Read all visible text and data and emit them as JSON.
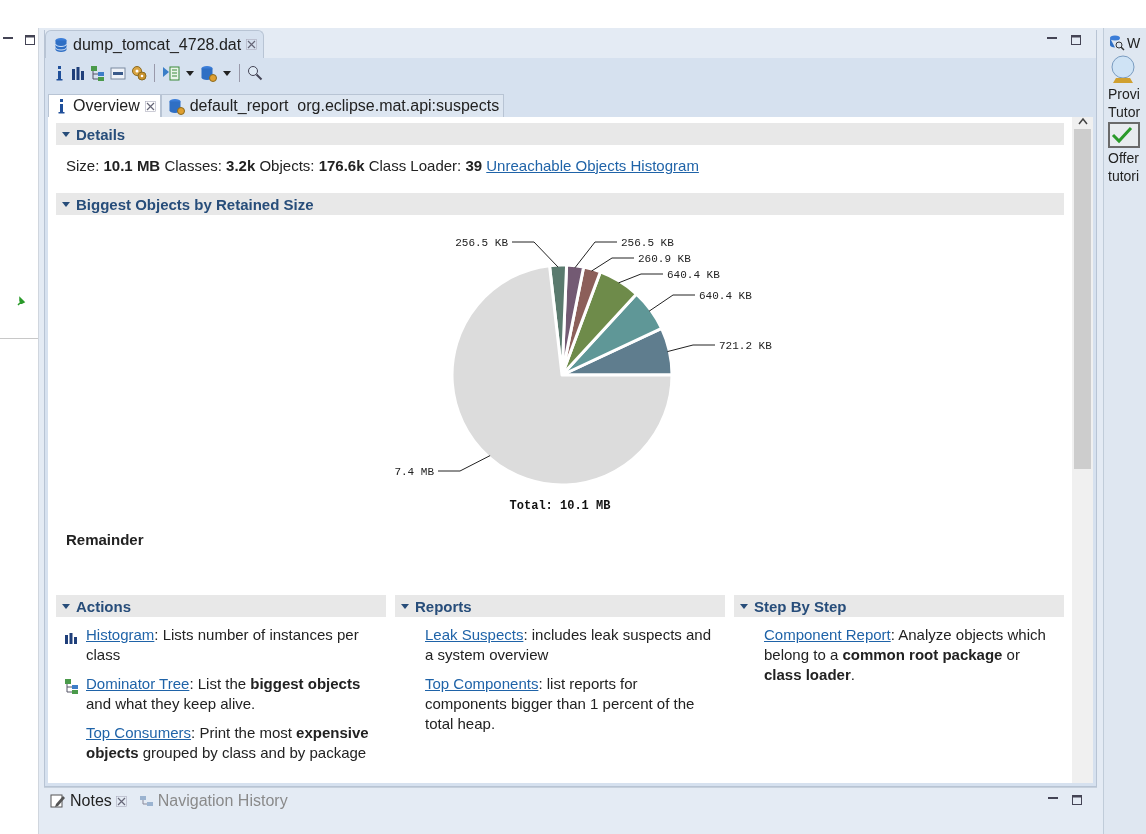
{
  "editor": {
    "title": "dump_tomcat_4728.dat"
  },
  "subtabs": [
    {
      "label": "Overview",
      "kind": "info",
      "selected": true
    },
    {
      "label": "default_report  org.eclipse.mat.api:suspects",
      "kind": "report",
      "selected": false
    }
  ],
  "details": {
    "heading": "Details",
    "expanded": true,
    "summary": "Size: **10.1 MB** Classes: **3.2k** Objects: **176.6k** Class Loader: **39**",
    "link": "Unreachable Objects Histogram"
  },
  "biggest_objects": {
    "heading": "Biggest Objects by Retained Size",
    "expanded": true,
    "chart_data": {
      "type": "pie",
      "title": "Total: 10.1 MB",
      "categories": [
        "721.2 KB",
        "640.4 KB",
        "640.4 KB",
        "260.9 KB",
        "256.5 KB",
        "256.5 KB",
        "7.4 MB"
      ],
      "values": [
        721.2,
        640.4,
        640.4,
        260.9,
        256.5,
        256.5,
        7577.6
      ],
      "colors": [
        "#5f7d8e",
        "#5f9797",
        "#6e8b4a",
        "#8c5f5a",
        "#735a73",
        "#5a7a6e",
        "#dcdcdc"
      ]
    },
    "remainder": "Remainder"
  },
  "columns": [
    {
      "heading": "Actions",
      "expanded": true,
      "items": [
        {
          "kind": "histogram",
          "link": "Histogram",
          "text": ": Lists number of instances per class"
        },
        {
          "kind": "tree",
          "link": "Dominator Tree",
          "text": ": List the **biggest objects** and what they keep alive."
        },
        {
          "kind": "plain",
          "link": "Top Consumers",
          "text": ": Print the most **expensive objects** grouped by class and by package"
        }
      ]
    },
    {
      "heading": "Reports",
      "expanded": true,
      "items": [
        {
          "kind": "plain",
          "link": "Leak Suspects",
          "text": ": includes leak suspects and a system overview"
        },
        {
          "kind": "plain",
          "link": "Top Components",
          "text": ": list reports for components bigger than 1 percent of the total heap."
        }
      ]
    },
    {
      "heading": "Step By Step",
      "expanded": true,
      "items": [
        {
          "kind": "plain",
          "link": "Component Report",
          "text": ": Analyze objects which belong to a **common root package** or **class loader**."
        }
      ]
    }
  ],
  "bottom_tabs": [
    {
      "label": "Notes",
      "kind": "notes",
      "selected": true
    },
    {
      "label": "Navigation History",
      "kind": "history",
      "selected": false
    }
  ],
  "right_panel": {
    "title": "W",
    "texts": [
      "Provi",
      "Tutor",
      "Offer",
      "tutori"
    ]
  }
}
